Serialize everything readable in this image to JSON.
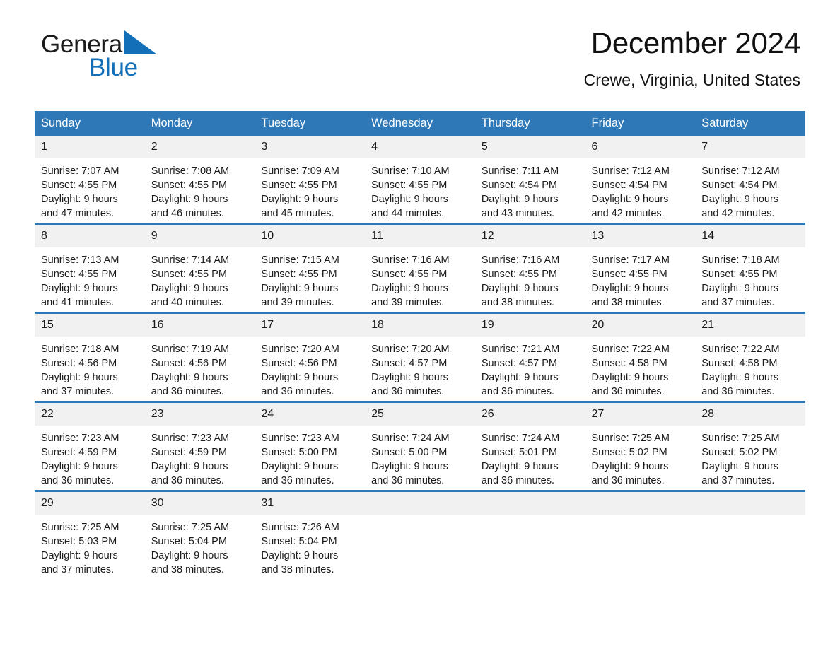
{
  "brand": {
    "name_dark": "General",
    "name_blue": "Blue",
    "triangle_color": "#126FB8"
  },
  "header": {
    "title": "December 2024",
    "location": "Crewe, Virginia, United States"
  },
  "theme": {
    "header_blue": "#2E78B8",
    "daynum_band": "#F1F1F1",
    "text": "#1a1a1a"
  },
  "weekday_headers": [
    "Sunday",
    "Monday",
    "Tuesday",
    "Wednesday",
    "Thursday",
    "Friday",
    "Saturday"
  ],
  "weeks": [
    [
      {
        "day": "1",
        "sunrise": "Sunrise: 7:07 AM",
        "sunset": "Sunset: 4:55 PM",
        "daylight1": "Daylight: 9 hours",
        "daylight2": "and 47 minutes."
      },
      {
        "day": "2",
        "sunrise": "Sunrise: 7:08 AM",
        "sunset": "Sunset: 4:55 PM",
        "daylight1": "Daylight: 9 hours",
        "daylight2": "and 46 minutes."
      },
      {
        "day": "3",
        "sunrise": "Sunrise: 7:09 AM",
        "sunset": "Sunset: 4:55 PM",
        "daylight1": "Daylight: 9 hours",
        "daylight2": "and 45 minutes."
      },
      {
        "day": "4",
        "sunrise": "Sunrise: 7:10 AM",
        "sunset": "Sunset: 4:55 PM",
        "daylight1": "Daylight: 9 hours",
        "daylight2": "and 44 minutes."
      },
      {
        "day": "5",
        "sunrise": "Sunrise: 7:11 AM",
        "sunset": "Sunset: 4:54 PM",
        "daylight1": "Daylight: 9 hours",
        "daylight2": "and 43 minutes."
      },
      {
        "day": "6",
        "sunrise": "Sunrise: 7:12 AM",
        "sunset": "Sunset: 4:54 PM",
        "daylight1": "Daylight: 9 hours",
        "daylight2": "and 42 minutes."
      },
      {
        "day": "7",
        "sunrise": "Sunrise: 7:12 AM",
        "sunset": "Sunset: 4:54 PM",
        "daylight1": "Daylight: 9 hours",
        "daylight2": "and 42 minutes."
      }
    ],
    [
      {
        "day": "8",
        "sunrise": "Sunrise: 7:13 AM",
        "sunset": "Sunset: 4:55 PM",
        "daylight1": "Daylight: 9 hours",
        "daylight2": "and 41 minutes."
      },
      {
        "day": "9",
        "sunrise": "Sunrise: 7:14 AM",
        "sunset": "Sunset: 4:55 PM",
        "daylight1": "Daylight: 9 hours",
        "daylight2": "and 40 minutes."
      },
      {
        "day": "10",
        "sunrise": "Sunrise: 7:15 AM",
        "sunset": "Sunset: 4:55 PM",
        "daylight1": "Daylight: 9 hours",
        "daylight2": "and 39 minutes."
      },
      {
        "day": "11",
        "sunrise": "Sunrise: 7:16 AM",
        "sunset": "Sunset: 4:55 PM",
        "daylight1": "Daylight: 9 hours",
        "daylight2": "and 39 minutes."
      },
      {
        "day": "12",
        "sunrise": "Sunrise: 7:16 AM",
        "sunset": "Sunset: 4:55 PM",
        "daylight1": "Daylight: 9 hours",
        "daylight2": "and 38 minutes."
      },
      {
        "day": "13",
        "sunrise": "Sunrise: 7:17 AM",
        "sunset": "Sunset: 4:55 PM",
        "daylight1": "Daylight: 9 hours",
        "daylight2": "and 38 minutes."
      },
      {
        "day": "14",
        "sunrise": "Sunrise: 7:18 AM",
        "sunset": "Sunset: 4:55 PM",
        "daylight1": "Daylight: 9 hours",
        "daylight2": "and 37 minutes."
      }
    ],
    [
      {
        "day": "15",
        "sunrise": "Sunrise: 7:18 AM",
        "sunset": "Sunset: 4:56 PM",
        "daylight1": "Daylight: 9 hours",
        "daylight2": "and 37 minutes."
      },
      {
        "day": "16",
        "sunrise": "Sunrise: 7:19 AM",
        "sunset": "Sunset: 4:56 PM",
        "daylight1": "Daylight: 9 hours",
        "daylight2": "and 36 minutes."
      },
      {
        "day": "17",
        "sunrise": "Sunrise: 7:20 AM",
        "sunset": "Sunset: 4:56 PM",
        "daylight1": "Daylight: 9 hours",
        "daylight2": "and 36 minutes."
      },
      {
        "day": "18",
        "sunrise": "Sunrise: 7:20 AM",
        "sunset": "Sunset: 4:57 PM",
        "daylight1": "Daylight: 9 hours",
        "daylight2": "and 36 minutes."
      },
      {
        "day": "19",
        "sunrise": "Sunrise: 7:21 AM",
        "sunset": "Sunset: 4:57 PM",
        "daylight1": "Daylight: 9 hours",
        "daylight2": "and 36 minutes."
      },
      {
        "day": "20",
        "sunrise": "Sunrise: 7:22 AM",
        "sunset": "Sunset: 4:58 PM",
        "daylight1": "Daylight: 9 hours",
        "daylight2": "and 36 minutes."
      },
      {
        "day": "21",
        "sunrise": "Sunrise: 7:22 AM",
        "sunset": "Sunset: 4:58 PM",
        "daylight1": "Daylight: 9 hours",
        "daylight2": "and 36 minutes."
      }
    ],
    [
      {
        "day": "22",
        "sunrise": "Sunrise: 7:23 AM",
        "sunset": "Sunset: 4:59 PM",
        "daylight1": "Daylight: 9 hours",
        "daylight2": "and 36 minutes."
      },
      {
        "day": "23",
        "sunrise": "Sunrise: 7:23 AM",
        "sunset": "Sunset: 4:59 PM",
        "daylight1": "Daylight: 9 hours",
        "daylight2": "and 36 minutes."
      },
      {
        "day": "24",
        "sunrise": "Sunrise: 7:23 AM",
        "sunset": "Sunset: 5:00 PM",
        "daylight1": "Daylight: 9 hours",
        "daylight2": "and 36 minutes."
      },
      {
        "day": "25",
        "sunrise": "Sunrise: 7:24 AM",
        "sunset": "Sunset: 5:00 PM",
        "daylight1": "Daylight: 9 hours",
        "daylight2": "and 36 minutes."
      },
      {
        "day": "26",
        "sunrise": "Sunrise: 7:24 AM",
        "sunset": "Sunset: 5:01 PM",
        "daylight1": "Daylight: 9 hours",
        "daylight2": "and 36 minutes."
      },
      {
        "day": "27",
        "sunrise": "Sunrise: 7:25 AM",
        "sunset": "Sunset: 5:02 PM",
        "daylight1": "Daylight: 9 hours",
        "daylight2": "and 36 minutes."
      },
      {
        "day": "28",
        "sunrise": "Sunrise: 7:25 AM",
        "sunset": "Sunset: 5:02 PM",
        "daylight1": "Daylight: 9 hours",
        "daylight2": "and 37 minutes."
      }
    ],
    [
      {
        "day": "29",
        "sunrise": "Sunrise: 7:25 AM",
        "sunset": "Sunset: 5:03 PM",
        "daylight1": "Daylight: 9 hours",
        "daylight2": "and 37 minutes."
      },
      {
        "day": "30",
        "sunrise": "Sunrise: 7:25 AM",
        "sunset": "Sunset: 5:04 PM",
        "daylight1": "Daylight: 9 hours",
        "daylight2": "and 38 minutes."
      },
      {
        "day": "31",
        "sunrise": "Sunrise: 7:26 AM",
        "sunset": "Sunset: 5:04 PM",
        "daylight1": "Daylight: 9 hours",
        "daylight2": "and 38 minutes."
      },
      {
        "day": "",
        "sunrise": "",
        "sunset": "",
        "daylight1": "",
        "daylight2": ""
      },
      {
        "day": "",
        "sunrise": "",
        "sunset": "",
        "daylight1": "",
        "daylight2": ""
      },
      {
        "day": "",
        "sunrise": "",
        "sunset": "",
        "daylight1": "",
        "daylight2": ""
      },
      {
        "day": "",
        "sunrise": "",
        "sunset": "",
        "daylight1": "",
        "daylight2": ""
      }
    ]
  ]
}
